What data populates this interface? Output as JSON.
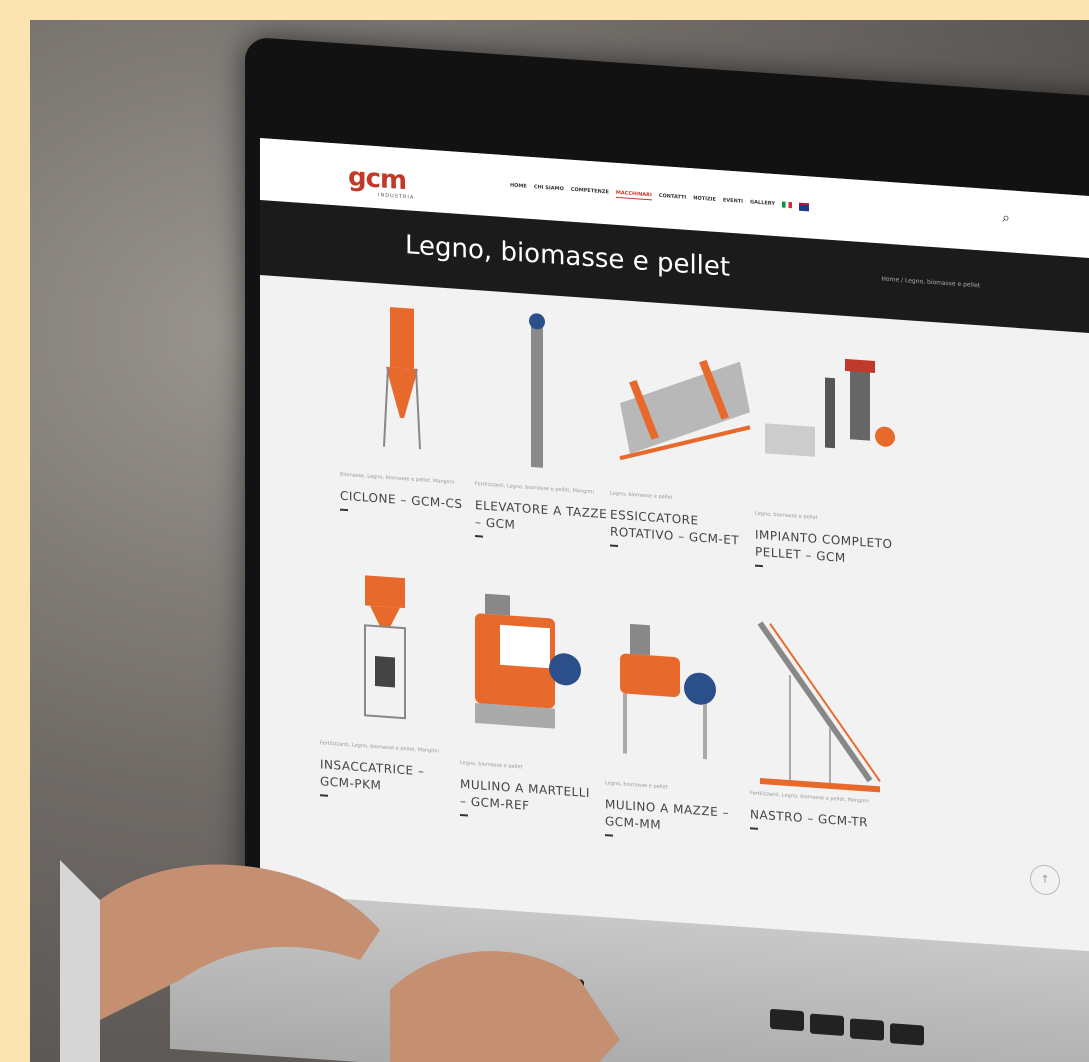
{
  "site": {
    "logo": "gcm",
    "logo_sub": "INDUSTRIA",
    "menu": [
      {
        "label": "HOME",
        "active": false
      },
      {
        "label": "CHI SIAMO",
        "active": false
      },
      {
        "label": "COMPETENZE",
        "active": false
      },
      {
        "label": "MACCHINARI",
        "active": true
      },
      {
        "label": "CONTATTI",
        "active": false
      },
      {
        "label": "NOTIZIE",
        "active": false
      },
      {
        "label": "EVENTI",
        "active": false
      },
      {
        "label": "GALLERY",
        "active": false
      }
    ],
    "search_icon": "search-icon"
  },
  "hero": {
    "title": "Legno, biomasse e pellet",
    "breadcrumb": "Home / Legno, biomasse e pellet"
  },
  "products": [
    {
      "category": "Biomasse, Legno, biomasse e pellet, Mangimi",
      "title": "CICLONE – GCM-CS"
    },
    {
      "category": "Fertilizzanti, Legno, biomasse e pellet, Mangimi",
      "title": "ELEVATORE A TAZZE – GCM"
    },
    {
      "category": "Legno, biomasse e pellet",
      "title": "ESSICCATORE ROTATIVO – GCM-ET"
    },
    {
      "category": "Legno, biomasse e pellet",
      "title": "IMPIANTO COMPLETO PELLET – GCM"
    },
    {
      "category": "Fertilizzanti, Legno, biomasse e pellet, Mangimi",
      "title": "INSACCATRICE – GCM-PKM"
    },
    {
      "category": "Legno, biomasse e pellet",
      "title": "MULINO A MARTELLI – GCM-REF"
    },
    {
      "category": "Legno, biomasse e pellet",
      "title": "MULINO A MAZZE – GCM-MM"
    },
    {
      "category": "Fertilizzanti, Legno, biomasse e pellet, Mangimi",
      "title": "NASTRO – GCM-TR"
    }
  ],
  "colors": {
    "brand": "#c0392b",
    "machine_orange": "#e8692c"
  },
  "to_top_icon": "arrow-up-icon",
  "to_top_glyph": "↑"
}
